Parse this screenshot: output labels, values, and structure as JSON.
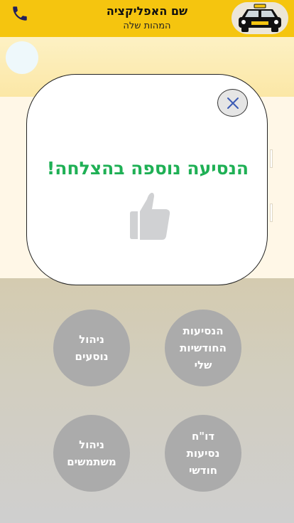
{
  "header": {
    "app_title": "שם האפליקציה",
    "app_subtitle": "המהות שלה",
    "phone_icon": "phone-icon",
    "logo_icon": "taxi-icon",
    "brand_color": "#f5c50f"
  },
  "modal": {
    "message": "הנסיעה נוספה בהצלחה!",
    "close_icon": "close-icon",
    "thumb_icon": "thumbs-up-icon",
    "message_color": "#1fb055"
  },
  "menu": {
    "monthly_rides": "הנסיעות\nהחודשיות\nשלי",
    "manage_passengers": "ניהול\nנוסעים",
    "monthly_report": "דו\"ח\nנסיעות\nחודשי",
    "manage_users": "ניהול\nמשתמשים"
  }
}
